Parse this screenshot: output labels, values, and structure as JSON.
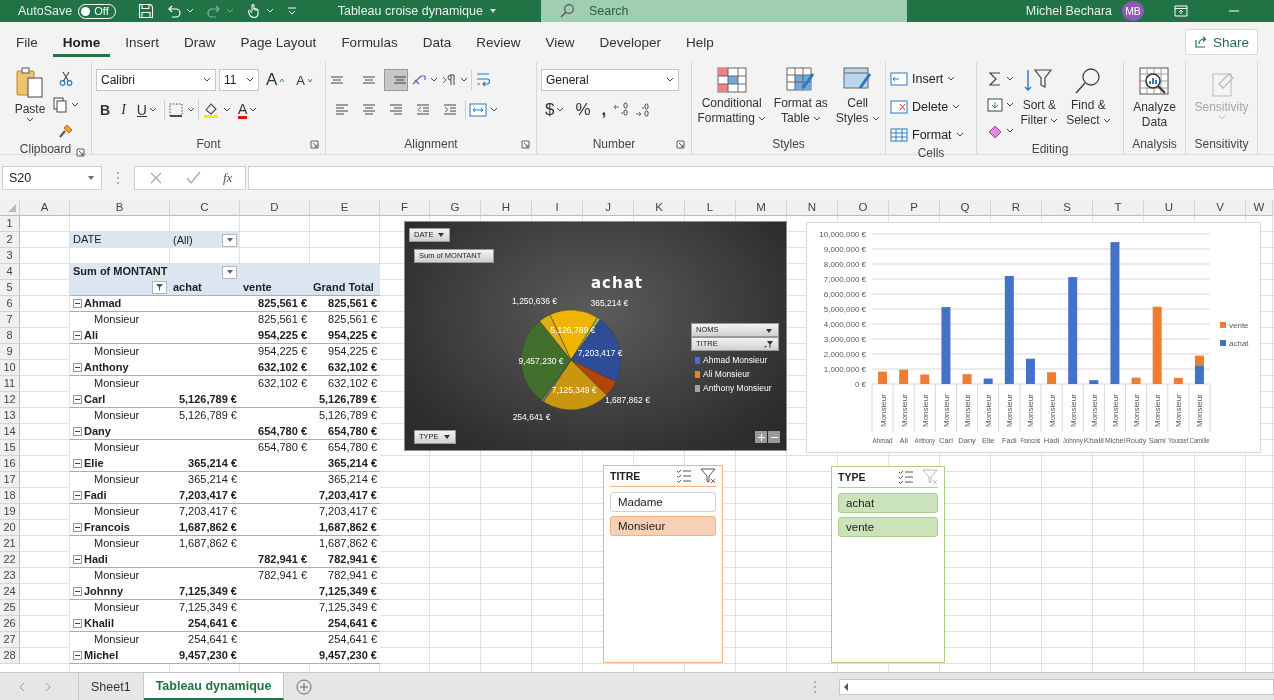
{
  "title_bar": {
    "autosave_label": "AutoSave",
    "autosave": {
      "on": false,
      "label": "Off"
    },
    "redo": {
      "disabled": true
    },
    "title": "Tableau croise dynamique",
    "search_placeholder": "Search",
    "user": "Michel Bechara",
    "avatar": "MB"
  },
  "menu_tabs": [
    {
      "label": "File",
      "selected": false
    },
    {
      "label": "Home",
      "selected": true
    },
    {
      "label": "Insert",
      "selected": false
    },
    {
      "label": "Draw",
      "selected": false
    },
    {
      "label": "Page Layout",
      "selected": false
    },
    {
      "label": "Formulas",
      "selected": false
    },
    {
      "label": "Data",
      "selected": false
    },
    {
      "label": "Review",
      "selected": false
    },
    {
      "label": "View",
      "selected": false
    },
    {
      "label": "Developer",
      "selected": false
    },
    {
      "label": "Help",
      "selected": false
    }
  ],
  "share": "Share",
  "ribbon": {
    "clipboard": {
      "label": "Clipboard",
      "paste": "Paste"
    },
    "font": {
      "label": "Font",
      "name": "Calibri",
      "size": "11",
      "grow": "A",
      "shrink": "A",
      "bold": "B",
      "italic": "I",
      "underline": "U",
      "font_color": "A"
    },
    "alignment": {
      "label": "Alignment",
      "valign": [
        {
          "selected": false
        },
        {
          "selected": false
        },
        {
          "selected": true
        }
      ]
    },
    "number": {
      "label": "Number",
      "format": "General",
      "currency": "$",
      "percent": "%",
      "comma": ","
    },
    "styles": {
      "label": "Styles",
      "conditional": [
        "Conditional",
        "Formatting"
      ],
      "format_table": [
        "Format as",
        "Table"
      ],
      "cell_styles": [
        "Cell",
        "Styles"
      ]
    },
    "cells": {
      "label": "Cells",
      "insert": "Insert",
      "delete": "Delete",
      "format": "Format"
    },
    "editing": {
      "label": "Editing",
      "sort": [
        "Sort &",
        "Filter"
      ],
      "find": [
        "Find &",
        "Select"
      ]
    },
    "analysis": {
      "label": "Analysis",
      "analyze": [
        "Analyze",
        "Data"
      ]
    },
    "sensitivity": {
      "label": "Sensitivity",
      "button": "Sensitivity",
      "disabled": true
    }
  },
  "formula_bar": {
    "name_box": "S20",
    "fx": "fx"
  },
  "sheet": {
    "columns": [
      "A",
      "B",
      "C",
      "D",
      "E",
      "F",
      "G",
      "H",
      "I",
      "J",
      "K",
      "L",
      "M",
      "N",
      "O",
      "P",
      "Q",
      "R",
      "S",
      "T",
      "U",
      "V",
      "W"
    ],
    "row_numbers": [
      "1",
      "2",
      "3",
      "4",
      "5",
      "6",
      "7",
      "8",
      "9",
      "10",
      "11",
      "12",
      "13",
      "14",
      "15",
      "16",
      "17",
      "18",
      "19",
      "20",
      "21",
      "22",
      "23",
      "24",
      "25",
      "26",
      "27",
      "28"
    ]
  },
  "pivot": {
    "filter": {
      "label": "DATE",
      "value": "(All)"
    },
    "title": "Sum of MONTANT",
    "columns": [
      "achat",
      "vente",
      "Grand Total"
    ],
    "groups": [
      {
        "name": "Ahmad",
        "expanded": true,
        "vente": "825,561 €",
        "total": "825,561 €",
        "children": [
          {
            "name": "Monsieur",
            "vente": "825,561 €",
            "total": "825,561 €"
          }
        ]
      },
      {
        "name": "Ali",
        "expanded": true,
        "vente": "954,225 €",
        "total": "954,225 €",
        "children": [
          {
            "name": "Monsieur",
            "vente": "954,225 €",
            "total": "954,225 €"
          }
        ]
      },
      {
        "name": "Anthony",
        "expanded": true,
        "vente": "632,102 €",
        "total": "632,102 €",
        "children": [
          {
            "name": "Monsieur",
            "vente": "632,102 €",
            "total": "632,102 €"
          }
        ]
      },
      {
        "name": "Carl",
        "expanded": true,
        "achat": "5,126,789 €",
        "total": "5,126,789 €",
        "children": [
          {
            "name": "Monsieur",
            "achat": "5,126,789 €",
            "total": "5,126,789 €"
          }
        ]
      },
      {
        "name": "Dany",
        "expanded": true,
        "vente": "654,780 €",
        "total": "654,780 €",
        "children": [
          {
            "name": "Monsieur",
            "vente": "654,780 €",
            "total": "654,780 €"
          }
        ]
      },
      {
        "name": "Elie",
        "expanded": true,
        "achat": "365,214 €",
        "total": "365,214 €",
        "children": [
          {
            "name": "Monsieur",
            "achat": "365,214 €",
            "total": "365,214 €"
          }
        ]
      },
      {
        "name": "Fadi",
        "expanded": true,
        "achat": "7,203,417 €",
        "total": "7,203,417 €",
        "children": [
          {
            "name": "Monsieur",
            "achat": "7,203,417 €",
            "total": "7,203,417 €"
          }
        ]
      },
      {
        "name": "Francois",
        "expanded": true,
        "achat": "1,687,862 €",
        "total": "1,687,862 €",
        "children": [
          {
            "name": "Monsieur",
            "achat": "1,687,862 €",
            "total": "1,687,862 €"
          }
        ]
      },
      {
        "name": "Hadi",
        "expanded": true,
        "vente": "782,941 €",
        "total": "782,941 €",
        "children": [
          {
            "name": "Monsieur",
            "vente": "782,941 €",
            "total": "782,941 €"
          }
        ]
      },
      {
        "name": "Johnny",
        "expanded": true,
        "achat": "7,125,349 €",
        "total": "7,125,349 €",
        "children": [
          {
            "name": "Monsieur",
            "achat": "7,125,349 €",
            "total": "7,125,349 €"
          }
        ]
      },
      {
        "name": "Khalil",
        "expanded": true,
        "achat": "254,641 €",
        "total": "254,641 €",
        "children": [
          {
            "name": "Monsieur",
            "achat": "254,641 €",
            "total": "254,641 €"
          }
        ]
      },
      {
        "name": "Michel",
        "expanded": true,
        "achat": "9,457,230 €",
        "total": "9,457,230 €"
      }
    ]
  },
  "pie_chart": {
    "buttons": {
      "date": "DATE",
      "values": "Sum of MONTANT",
      "type": "TYPE"
    },
    "legend_fields": [
      {
        "label": "NOMS",
        "filtered": false
      },
      {
        "label": "TITRE",
        "filtered": true
      }
    ],
    "legend": [
      {
        "label": "Ahmad Monsieur",
        "color": "#4472c4"
      },
      {
        "label": "Ali Monsieur",
        "color": "#ed7d31"
      },
      {
        "label": "Anthony Monsieur",
        "color": "#a5a5a5"
      }
    ],
    "chart_data": {
      "type": "pie",
      "title": "achat",
      "values": [
        5126789,
        365214,
        7203417,
        1687862,
        7125349,
        254641,
        9457230,
        1250636
      ],
      "value_labels": [
        "5,126,789 €",
        "365,214 €",
        "7,203,417 €",
        "1,687,862 €",
        "7,125,349 €",
        "254,641 €",
        "9,457,230 €",
        "1,250,636 €"
      ]
    }
  },
  "bar_chart": {
    "inner_labels": [
      "Monsieur",
      "Monsieur",
      "Monsieur",
      "Monsieur",
      "Monsieur",
      "Monsieur",
      "Monsieur",
      "Monsieur",
      "Monsieur",
      "Monsieur",
      "Monsieur",
      "Monsieur",
      "Monsieur",
      "Monsieur",
      "Monsieur",
      "Monsieur"
    ],
    "chart_data": {
      "type": "bar",
      "stacked": true,
      "grid": true,
      "legend": true,
      "categories": [
        "Ahmad",
        "Ali",
        "Anthony",
        "Carl",
        "Dany",
        "Elie",
        "Fadi",
        "Francois",
        "Hadi",
        "Johnny",
        "Khalil",
        "Michel",
        "Roudy",
        "Sami",
        "Youssef",
        "Camille"
      ],
      "series": [
        {
          "name": "achat",
          "color": "#4472c4",
          "values": [
            null,
            null,
            null,
            5126789,
            null,
            365214,
            7203417,
            1687862,
            null,
            7125349,
            254641,
            9457230,
            null,
            null,
            null,
            1250636
          ]
        },
        {
          "name": "vente",
          "color": "#ed7d31",
          "values": [
            825561,
            954225,
            632102,
            null,
            654780,
            null,
            null,
            null,
            782941,
            null,
            null,
            null,
            420000,
            5150000,
            410000,
            640000
          ]
        }
      ],
      "ylim": [
        0,
        10000000
      ],
      "yticks": [
        {
          "value": 0,
          "label": "0 €"
        },
        {
          "value": 1000000,
          "label": "1,000,000 €"
        },
        {
          "value": 2000000,
          "label": "2,000,000 €"
        },
        {
          "value": 3000000,
          "label": "3,000,000 €"
        },
        {
          "value": 4000000,
          "label": "4,000,000 €"
        },
        {
          "value": 5000000,
          "label": "5,000,000 €"
        },
        {
          "value": 6000000,
          "label": "6,000,000 €"
        },
        {
          "value": 7000000,
          "label": "7,000,000 €"
        },
        {
          "value": 8000000,
          "label": "8,000,000 €"
        },
        {
          "value": 9000000,
          "label": "9,000,000 €"
        },
        {
          "value": 10000000,
          "label": "10,000,000 €"
        }
      ]
    }
  },
  "slicers": [
    {
      "title": "TITRE",
      "color": "#f4b183",
      "clear_enabled": true,
      "items": [
        {
          "label": "Madame",
          "selected": false
        },
        {
          "label": "Monsieur",
          "selected": true
        }
      ]
    },
    {
      "title": "TYPE",
      "color": "#a9d08e",
      "clear_enabled": false,
      "items": [
        {
          "label": "achat",
          "selected": true
        },
        {
          "label": "vente",
          "selected": true
        }
      ]
    }
  ],
  "sheet_tabs": [
    {
      "label": "Sheet1",
      "selected": false
    },
    {
      "label": "Tableau dynamique",
      "selected": true
    }
  ]
}
